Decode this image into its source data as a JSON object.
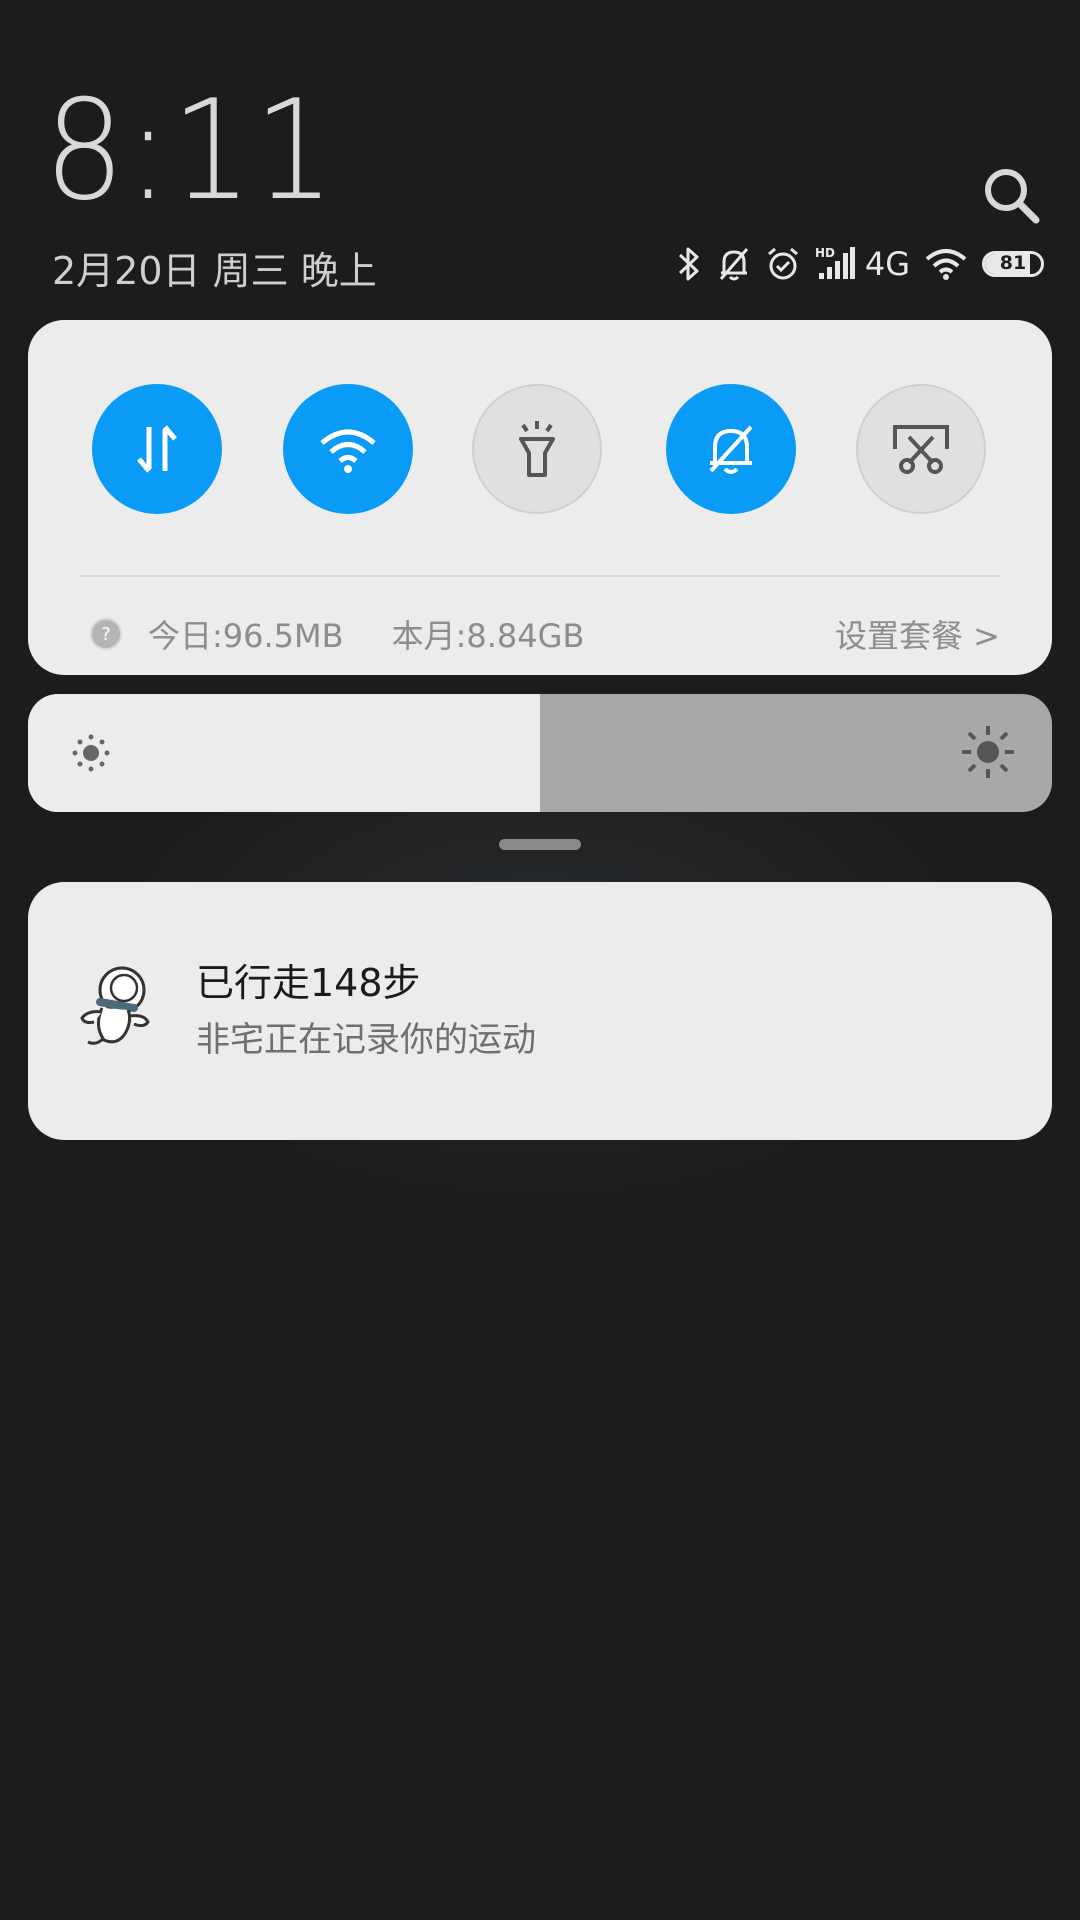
{
  "header": {
    "time": "8:11",
    "date": "2月20日 周三 晚上"
  },
  "status_bar": {
    "icons": [
      "bluetooth-icon",
      "mute-icon",
      "alarm-icon",
      "hd-signal-icon",
      "wifi-icon"
    ],
    "network_label": "4G",
    "battery_percent": "81",
    "battery_level": 0.81
  },
  "quick_settings": {
    "toggles": [
      {
        "name": "mobile-data",
        "icon": "data-transfer-icon",
        "state": "on"
      },
      {
        "name": "wifi",
        "icon": "wifi-icon",
        "state": "on"
      },
      {
        "name": "flashlight",
        "icon": "flashlight-icon",
        "state": "off"
      },
      {
        "name": "mute",
        "icon": "bell-off-icon",
        "state": "on"
      },
      {
        "name": "screenshot",
        "icon": "screenshot-icon",
        "state": "off"
      }
    ],
    "data_today": "今日:96.5MB",
    "data_month": "本月:8.84GB",
    "plan_link": "设置套餐 >"
  },
  "brightness": {
    "level": 0.5
  },
  "notification": {
    "title": "已行走148步",
    "body": "非宅正在记录你的运动"
  },
  "colors": {
    "background": "#1c1c1c",
    "accent": "#0a9bf6",
    "card": "#ececec"
  }
}
